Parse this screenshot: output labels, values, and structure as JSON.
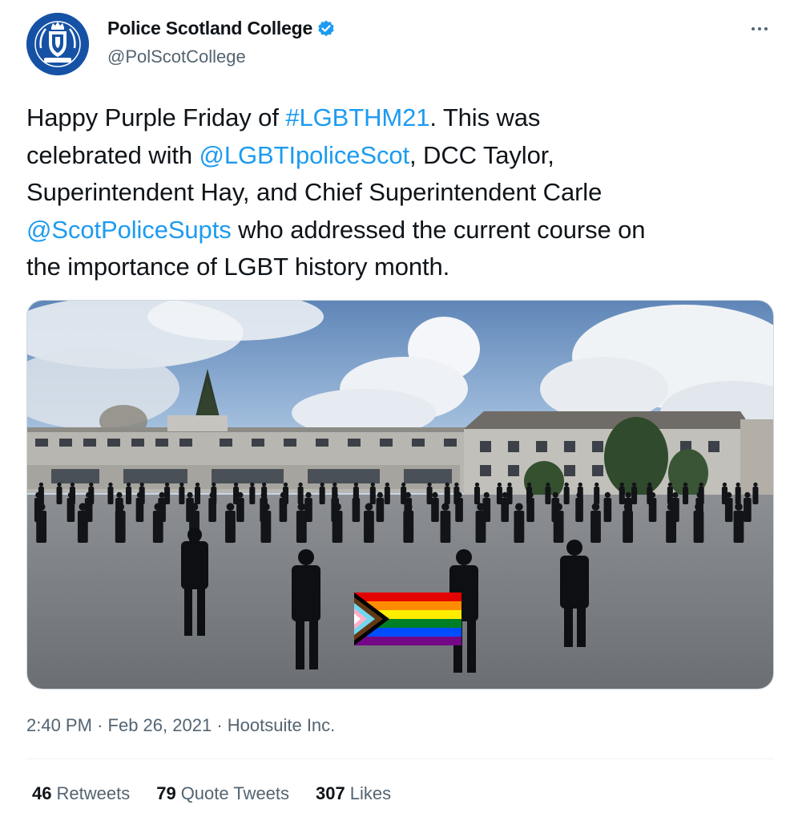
{
  "author": {
    "display_name": "Police Scotland College",
    "handle": "@PolScotCollege",
    "avatar_icon": "police-scotland-crest-icon",
    "verified_icon": "verified-badge-icon"
  },
  "tweet": {
    "lines": [
      [
        {
          "t": "Happy Purple Friday of ",
          "link": false
        },
        {
          "t": "#LGBTHM21",
          "link": true
        },
        {
          "t": ".  This was",
          "link": false
        }
      ],
      [
        {
          "t": "celebrated with ",
          "link": false
        },
        {
          "t": "@LGBTIpoliceScot",
          "link": true
        },
        {
          "t": ", DCC Taylor,",
          "link": false
        }
      ],
      [
        {
          "t": "Superintendent Hay, and Chief Superintendent Carle",
          "link": false
        }
      ],
      [
        {
          "t": "@ScotPoliceSupts",
          "link": true
        },
        {
          "t": " who addressed the current course on",
          "link": false
        }
      ],
      [
        {
          "t": "the importance of LGBT history month.",
          "link": false
        }
      ]
    ],
    "media_description_icon": "photo-officers-with-progress-pride-flag"
  },
  "meta": {
    "time": "2:40 PM",
    "separator": "·",
    "date": "Feb 26, 2021",
    "source": "Hootsuite Inc."
  },
  "stats": {
    "retweets_count": "46",
    "retweets_label": "Retweets",
    "quotes_count": "79",
    "quotes_label": "Quote Tweets",
    "likes_count": "307",
    "likes_label": "Likes"
  },
  "colors": {
    "link": "#1d9bf0",
    "secondary_text": "#536471",
    "primary_text": "#0f1419",
    "avatar_bg": "#1552a5",
    "verified": "#1d9bf0"
  }
}
